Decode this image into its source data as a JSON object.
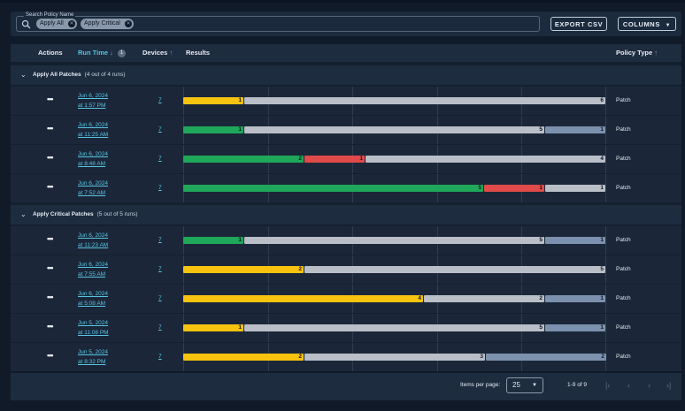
{
  "search": {
    "legend": "Search Policy Name",
    "chips": [
      "Apply All",
      "Apply Critical"
    ]
  },
  "toolbar": {
    "export_label": "EXPORT CSV",
    "columns_label": "COLUMNS"
  },
  "header": {
    "actions": "Actions",
    "runtime": "Run Time",
    "runtime_sort_badge": "1",
    "devices": "Devices",
    "results": "Results",
    "policytype": "Policy Type"
  },
  "colors": {
    "success": "#1fa85a",
    "failure": "#e04a48",
    "warning": "#f8c30f",
    "pending": "#c4c9d0",
    "other": "#7c91ad",
    "accent": "#58c3e2"
  },
  "groups": [
    {
      "name": "Apply All Patches",
      "count_text": "(4 out of 4 runs)",
      "rows": [
        {
          "date": "Jun 6, 2024",
          "time": "at 1:57 PM",
          "devices": "7",
          "type": "Patch",
          "segments": [
            {
              "status": "warning",
              "value": 1
            },
            {
              "status": "pending",
              "value": 6
            }
          ]
        },
        {
          "date": "Jun 6, 2024",
          "time": "at 11:25 AM",
          "devices": "7",
          "type": "Patch",
          "segments": [
            {
              "status": "success",
              "value": 1
            },
            {
              "status": "pending",
              "value": 5
            },
            {
              "status": "other",
              "value": 1
            }
          ]
        },
        {
          "date": "Jun 6, 2024",
          "time": "at 8:48 AM",
          "devices": "7",
          "type": "Patch",
          "segments": [
            {
              "status": "success",
              "value": 2
            },
            {
              "status": "failure",
              "value": 1
            },
            {
              "status": "pending",
              "value": 4
            }
          ]
        },
        {
          "date": "Jun 6, 2024",
          "time": "at 7:52 AM",
          "devices": "7",
          "type": "Patch",
          "segments": [
            {
              "status": "success",
              "value": 5
            },
            {
              "status": "failure",
              "value": 1
            },
            {
              "status": "pending",
              "value": 1
            }
          ]
        }
      ]
    },
    {
      "name": "Apply Critical Patches",
      "count_text": "(5 out of 5 runs)",
      "rows": [
        {
          "date": "Jun 6, 2024",
          "time": "at 11:23 AM",
          "devices": "7",
          "type": "Patch",
          "segments": [
            {
              "status": "success",
              "value": 1
            },
            {
              "status": "pending",
              "value": 5
            },
            {
              "status": "other",
              "value": 1
            }
          ]
        },
        {
          "date": "Jun 6, 2024",
          "time": "at 7:55 AM",
          "devices": "7",
          "type": "Patch",
          "segments": [
            {
              "status": "warning",
              "value": 2
            },
            {
              "status": "pending",
              "value": 5
            }
          ]
        },
        {
          "date": "Jun 6, 2024",
          "time": "at 5:08 AM",
          "devices": "7",
          "type": "Patch",
          "segments": [
            {
              "status": "warning",
              "value": 4
            },
            {
              "status": "pending",
              "value": 2
            },
            {
              "status": "other",
              "value": 1
            }
          ]
        },
        {
          "date": "Jun 5, 2024",
          "time": "at 11:08 PM",
          "devices": "7",
          "type": "Patch",
          "segments": [
            {
              "status": "warning",
              "value": 1
            },
            {
              "status": "pending",
              "value": 5
            },
            {
              "status": "other",
              "value": 1
            }
          ]
        },
        {
          "date": "Jun 5, 2024",
          "time": "at 8:32 PM",
          "devices": "7",
          "type": "Patch",
          "segments": [
            {
              "status": "warning",
              "value": 2
            },
            {
              "status": "pending",
              "value": 3
            },
            {
              "status": "other",
              "value": 2
            }
          ]
        }
      ]
    }
  ],
  "footer": {
    "items_per_page_label": "Items per page:",
    "items_per_page_value": "25",
    "range_text": "1-9 of 9"
  },
  "icons": {
    "search": "search-icon",
    "chip_remove": "close-icon",
    "sort_asc": "arrow-up-icon",
    "sort_desc": "arrow-down-icon",
    "row_menu": "more-horizontal-icon",
    "group_toggle": "chevron-down-icon"
  }
}
